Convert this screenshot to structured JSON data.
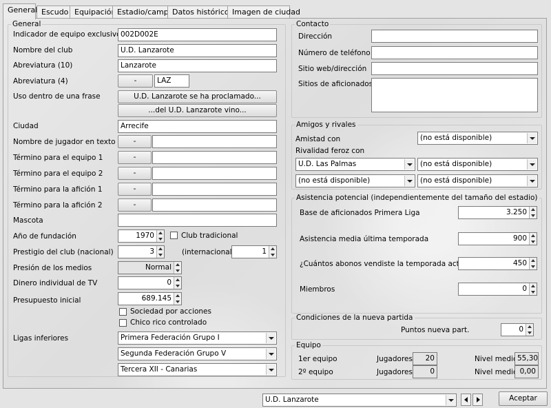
{
  "tabs": [
    "General",
    "Escudo",
    "Equipación",
    "Estadio/campo",
    "Datos históricos",
    "Imagen de ciudad"
  ],
  "general": {
    "legend": "General",
    "id_label": "Indicador de equipo exclusivo",
    "id_value": "002D002E",
    "club_label": "Nombre del club",
    "club_value": "U.D. Lanzarote",
    "abbr10_label": "Abreviatura (10)",
    "abbr10_value": "Lanzarote",
    "abbr4_label": "Abreviatura (4)",
    "abbr4_button": "-",
    "abbr4_value": "LAZ",
    "phrase_label": "Uso dentro de una frase",
    "phrase_btn1": "U.D. Lanzarote se ha proclamado...",
    "phrase_btn2": "...del U.D. Lanzarote vino...",
    "city_label": "Ciudad",
    "city_value": "Arrecife",
    "player_text_label": "Nombre de jugador en texto",
    "team1_label": "Término para el equipo 1",
    "team2_label": "Término para el equipo 2",
    "fans1_label": "Término para la afición 1",
    "fans2_label": "Término para la afición 2",
    "dash": "-",
    "mascot_label": "Mascota",
    "founded_label": "Año de fundación",
    "founded_value": "1970",
    "traditional_label": "Club tradicional",
    "prestige_label": "Prestigio del club (nacional)",
    "prestige_value": "3",
    "intl_label": "(internacional)",
    "intl_value": "1",
    "media_label": "Presión de los medios",
    "media_value": "Normal",
    "tv_label": "Dinero individual de TV",
    "tv_value": "0",
    "budget_label": "Presupuesto inicial",
    "budget_value": "689.145",
    "shares_label": "Sociedad por acciones",
    "rich_label": "Chico rico controlado",
    "lower_label": "Ligas inferiores",
    "lower_options": [
      "Primera Federación Grupo I",
      "Segunda Federación Grupo V",
      "Tercera XII - Canarias"
    ]
  },
  "contact": {
    "legend": "Contacto",
    "address_label": "Dirección",
    "phone_label": "Número de teléfono",
    "web_label": "Sitio web/dirección",
    "fansites_label": "Sitios de aficionados"
  },
  "friends": {
    "legend": "Amigos y rivales",
    "friendship_label": "Amistad con",
    "friendship_value": "(no está disponible)",
    "rivalry_label": "Rivalidad feroz con",
    "rival_a": "U.D. Las Palmas",
    "rival_b": "(no está disponible)",
    "rival_c": "(no está disponible)",
    "rival_d": "(no está disponible)"
  },
  "attendance": {
    "legend": "Asistencia potencial (independientemente del tamaño del estadio)",
    "fanbase_label": "Base de aficionados Primera Liga",
    "fanbase_value": "3.250",
    "avg_label": "Asistencia media última temporada",
    "avg_value": "900",
    "season_label": "¿Cuántos abonos vendiste la temporada actual?",
    "season_value": "450",
    "members_label": "Miembros",
    "members_value": "0"
  },
  "newgame": {
    "legend": "Condiciones de la nueva partida",
    "points_label": "Puntos nueva part.",
    "points_value": "0"
  },
  "squad": {
    "legend": "Equipo",
    "team1_label": "1er equipo",
    "team2_label": "2º equipo",
    "players_label": "Jugadores",
    "avg_label": "Nivel medio",
    "team1_players": "20",
    "team1_avg": "55,30",
    "team2_players": "0",
    "team2_avg": "0,00"
  },
  "footer": {
    "team_select": "U.D. Lanzarote",
    "accept": "Aceptar"
  }
}
